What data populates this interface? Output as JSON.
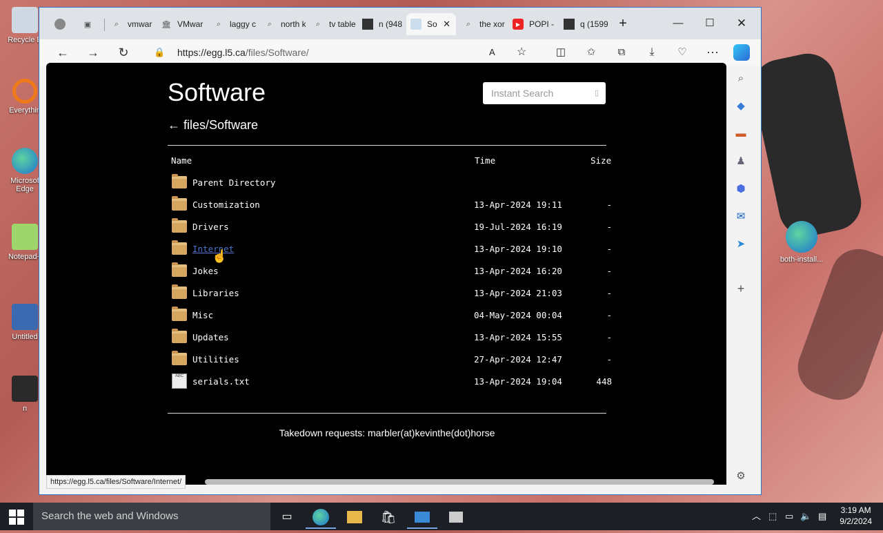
{
  "desktop": {
    "icons": [
      "Recycle E",
      "Everythin",
      "Microsof Edge",
      "Notepad+",
      "Untitled",
      "n",
      "both-install..."
    ]
  },
  "browser": {
    "tabs": [
      {
        "label": "vmwar",
        "icon": "search-icon"
      },
      {
        "label": "VMwar",
        "icon": "museum-icon"
      },
      {
        "label": "laggy c",
        "icon": "search-icon"
      },
      {
        "label": "north k",
        "icon": "search-icon"
      },
      {
        "label": "tv table",
        "icon": "search-icon"
      },
      {
        "label": "n (948",
        "icon": "image-icon"
      },
      {
        "label": "So",
        "icon": "page-icon"
      },
      {
        "label": "the xor",
        "icon": "search-icon"
      },
      {
        "label": "POPI -",
        "icon": "youtube-icon"
      },
      {
        "label": "q (1599",
        "icon": "image-icon"
      }
    ],
    "url_host": "https://egg.l5.ca",
    "url_path": "/files/Software/",
    "status_url": "https://egg.l5.ca/files/Software/Internet/"
  },
  "page": {
    "title": "Software",
    "search_placeholder": "Instant Search",
    "breadcrumb": "← files/Software",
    "columns": {
      "name": "Name",
      "time": "Time",
      "size": "Size"
    },
    "rows": [
      {
        "name": "Parent Directory",
        "time": "",
        "size": "",
        "kind": "folder"
      },
      {
        "name": "Customization",
        "time": "13-Apr-2024 19:11",
        "size": "-",
        "kind": "folder"
      },
      {
        "name": "Drivers",
        "time": "19-Jul-2024 16:19",
        "size": "-",
        "kind": "folder"
      },
      {
        "name": "Internet",
        "time": "13-Apr-2024 19:10",
        "size": "-",
        "kind": "folder"
      },
      {
        "name": "Jokes",
        "time": "13-Apr-2024 16:20",
        "size": "-",
        "kind": "folder"
      },
      {
        "name": "Libraries",
        "time": "13-Apr-2024 21:03",
        "size": "-",
        "kind": "folder"
      },
      {
        "name": "Misc",
        "time": "04-May-2024 00:04",
        "size": "-",
        "kind": "folder"
      },
      {
        "name": "Updates",
        "time": "13-Apr-2024 15:55",
        "size": "-",
        "kind": "folder"
      },
      {
        "name": "Utilities",
        "time": "27-Apr-2024 12:47",
        "size": "-",
        "kind": "folder"
      },
      {
        "name": "serials.txt",
        "time": "13-Apr-2024 19:04",
        "size": "448",
        "kind": "file"
      }
    ],
    "footer": "Takedown requests: marbler(at)kevinthe(dot)horse"
  },
  "taskbar": {
    "search_placeholder": "Search the web and Windows",
    "time": "3:19 AM",
    "date": "9/2/2024"
  }
}
